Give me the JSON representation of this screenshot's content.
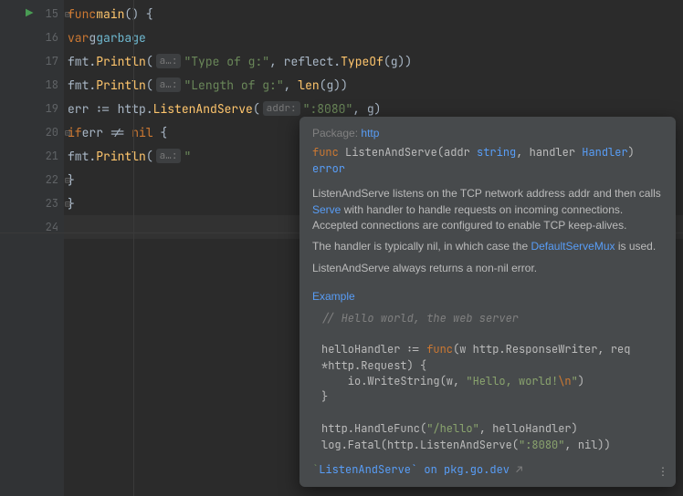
{
  "gutter": {
    "lines": [
      "15",
      "16",
      "17",
      "18",
      "19",
      "20",
      "21",
      "22",
      "23",
      "24"
    ]
  },
  "code": {
    "l15": {
      "kw_func": "func",
      "name": "main",
      "paren": "() {"
    },
    "l16": {
      "kw_var": "var",
      "g": "g",
      "ty": "garbage"
    },
    "l17": {
      "pkg": "fmt",
      "dot": ".",
      "fn": "Println",
      "open": "(",
      "hint": "a…:",
      "str": "\"Type of g:\"",
      "comma": ", ",
      "pkg2": "reflect",
      "dot2": ".",
      "fn2": "TypeOf",
      "open2": "(",
      "arg": "g",
      "close": "))"
    },
    "l18": {
      "pkg": "fmt",
      "dot": ".",
      "fn": "Println",
      "open": "(",
      "hint": "a…:",
      "str": "\"Length of g:\"",
      "comma": ", ",
      "fn2": "len",
      "open2": "(",
      "arg": "g",
      "close": "))"
    },
    "l19": {
      "err": "err",
      "assign": " := ",
      "pkg": "http",
      "dot": ".",
      "fn": "ListenAndServe",
      "open": "(",
      "hint": "addr:",
      "str": "\":8080\"",
      "comma": ", ",
      "arg": "g",
      "close": ")"
    },
    "l20": {
      "kw_if": "if",
      "err": "err",
      "neq": " != ",
      "nil": "nil",
      "open": " {"
    },
    "l21": {
      "pkg": "fmt",
      "dot": ".",
      "fn": "Println",
      "open": "(",
      "hint": "a…:",
      "str": "\""
    },
    "l22": {
      "close": "}"
    },
    "l23": {
      "close": "}"
    }
  },
  "popup": {
    "pkg_label": "Package:",
    "pkg_name": "http",
    "sig": {
      "func": "func",
      "name": "ListenAndServe(addr ",
      "string": "string",
      "mid": ", handler ",
      "handler": "Handler",
      "close": ") ",
      "error": "error"
    },
    "p1a": "ListenAndServe listens on the TCP network address addr and then calls ",
    "p1_link": "Serve",
    "p1b": " with handler to handle requests on incoming connections. Accepted connections are configured to enable TCP keep-alives.",
    "p2a": "The handler is typically nil, in which case the ",
    "p2_link": "DefaultServeMux",
    "p2b": " is used.",
    "p3": "ListenAndServe always returns a non-nil error.",
    "example_label": "Example",
    "ex_comment": "// Hello world, the web server",
    "ex_l1a": "helloHandler := ",
    "ex_l1_func": "func",
    "ex_l1b": "(w http.ResponseWriter, req",
    "ex_l2": "*http.Request) {",
    "ex_l3a": "    io.WriteString(w, ",
    "ex_l3_str": "\"Hello, world!",
    "ex_l3_esc": "\\n",
    "ex_l3_str2": "\"",
    "ex_l3b": ")",
    "ex_l4": "}",
    "ex_l6a": "http.HandleFunc(",
    "ex_l6_str": "\"/hello\"",
    "ex_l6b": ", helloHandler)",
    "ex_l7a": "log.Fatal(http.ListenAndServe(",
    "ex_l7_str": "\":8080\"",
    "ex_l7b": ", nil))",
    "ext_a": "`",
    "ext_link": "ListenAndServe` on pkg.go.dev",
    "ext_arrow": " ↗",
    "more": "⋮"
  }
}
